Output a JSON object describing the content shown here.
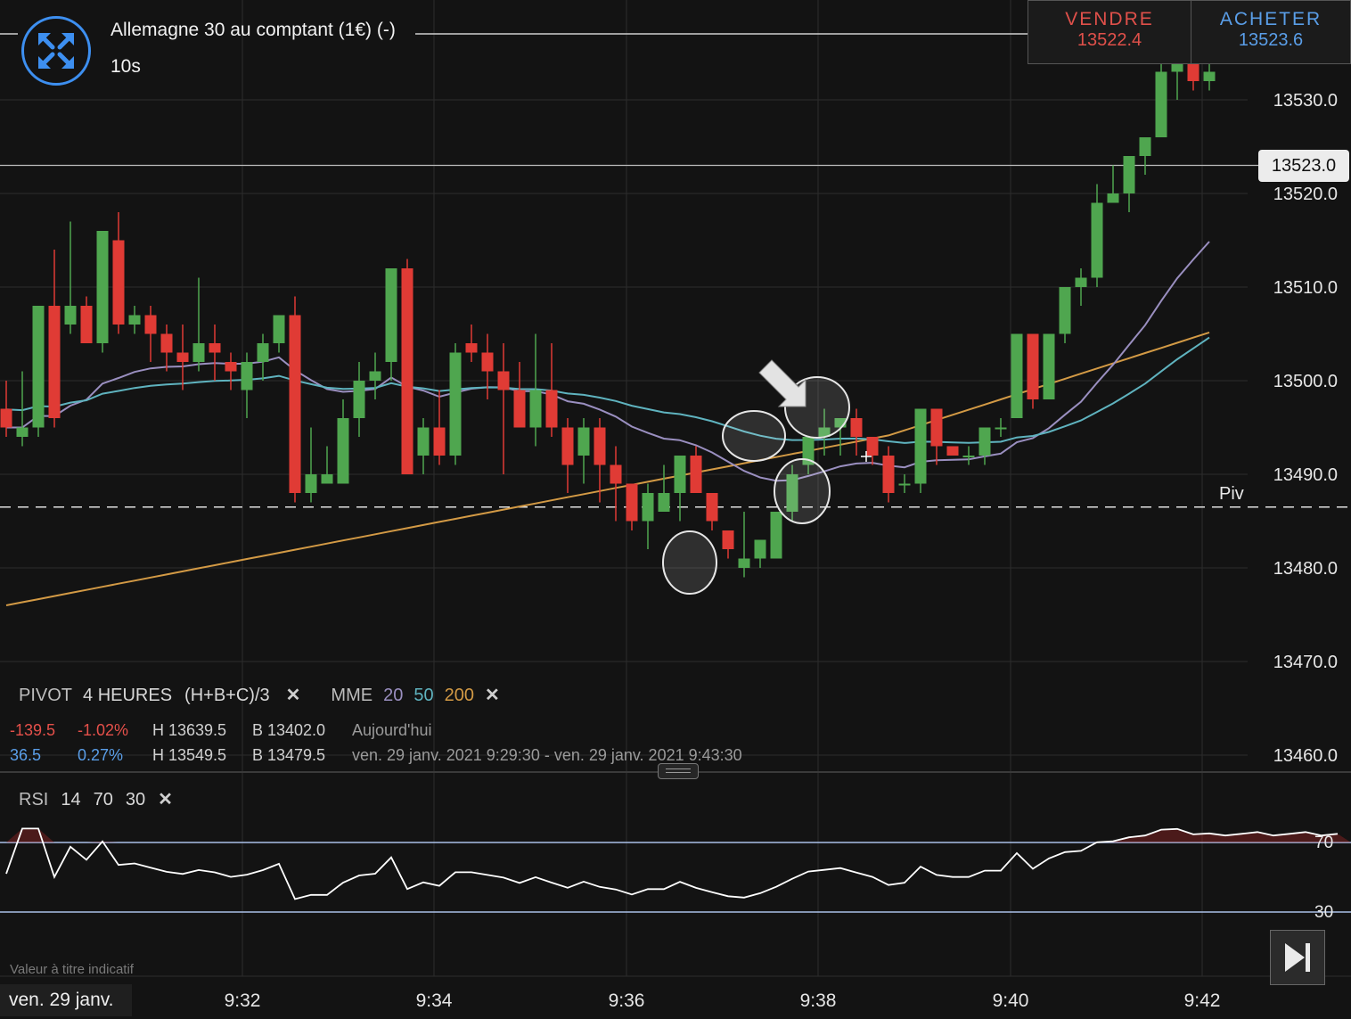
{
  "header": {
    "instrument": "Allemagne 30 au comptant (1€) (-)",
    "timeframe": "10s"
  },
  "trade": {
    "sell_label": "VENDRE",
    "sell_price": "13522.4",
    "buy_label": "ACHETER",
    "buy_price": "13523.6"
  },
  "current_price": "13523.0",
  "pivot_label": "Piv",
  "legend": {
    "pivot": "PIVOT",
    "pivot_period": "4 HEURES",
    "pivot_formula": "(H+B+C)/3",
    "mme": "MME",
    "mme_20": "20",
    "mme_50": "50",
    "mme_200": "200",
    "close": "✕"
  },
  "stats": {
    "row1": {
      "change": "-139.5",
      "pct": "-1.02%",
      "high": "H 13639.5",
      "low": "B 13402.0",
      "period": "Aujourd'hui"
    },
    "row2": {
      "change": "36.5",
      "pct": "0.27%",
      "high": "H 13549.5",
      "low": "B 13479.5",
      "period": "ven. 29 janv. 2021 9:29:30 - ven. 29 janv. 2021 9:43:30"
    }
  },
  "rsi": {
    "label": "RSI",
    "p1": "14",
    "p2": "70",
    "p3": "30",
    "upper": "70",
    "lower": "30"
  },
  "footer": {
    "date": "ven. 29 janv.",
    "disclaimer": "Valeur à titre indicatif"
  },
  "colors": {
    "up": "#4fa64f",
    "down": "#e03b35",
    "mme20": "#9a8fc0",
    "mme50": "#5fb3bf",
    "mme200": "#d39a45",
    "sell": "#e0504a",
    "buy": "#5a9ee8",
    "rsi_line": "#ffffff",
    "rsi_band": "#a9c0e8"
  },
  "icons": {
    "expand": "expand-arrows-icon",
    "skip": "skip-to-end-icon",
    "annotation": "arrow-pointer-icon"
  },
  "chart_data": {
    "type": "candlestick",
    "x_ticks": [
      "9:32",
      "9:34",
      "9:36",
      "9:38",
      "9:40",
      "9:42"
    ],
    "y_ticks": [
      "13530.0",
      "13520.0",
      "13510.0",
      "13500.0",
      "13490.0",
      "13480.0",
      "13470.0",
      "13460.0"
    ],
    "ylim": [
      13458,
      13540
    ],
    "pivot": 13486.5,
    "candles": [
      [
        13497,
        13500,
        13494,
        13495
      ],
      [
        13494,
        13501,
        13493,
        13495
      ],
      [
        13495,
        13505,
        13494,
        13508
      ],
      [
        13508,
        13514,
        13495,
        13496
      ],
      [
        13506,
        13517,
        13505,
        13508
      ],
      [
        13508,
        13509,
        13504,
        13504
      ],
      [
        13504,
        13516,
        13503,
        13516
      ],
      [
        13515,
        13518,
        13505,
        13506
      ],
      [
        13506,
        13508,
        13505,
        13507
      ],
      [
        13507,
        13508,
        13502,
        13505
      ],
      [
        13505,
        13506,
        13501,
        13503
      ],
      [
        13503,
        13506,
        13499,
        13502
      ],
      [
        13502,
        13511,
        13501,
        13504
      ],
      [
        13504,
        13506,
        13500,
        13503
      ],
      [
        13502,
        13503,
        13499,
        13501
      ],
      [
        13499,
        13503,
        13496,
        13502
      ],
      [
        13502,
        13505,
        13500,
        13504
      ],
      [
        13504,
        13507,
        13503,
        13507
      ],
      [
        13507,
        13509,
        13487,
        13488
      ],
      [
        13488,
        13495,
        13487,
        13490
      ],
      [
        13489,
        13493,
        13489,
        13490
      ],
      [
        13489,
        13498,
        13490,
        13496
      ],
      [
        13496,
        13502,
        13494,
        13500
      ],
      [
        13500,
        13503,
        13498,
        13501
      ],
      [
        13502,
        13512,
        13500,
        13512
      ],
      [
        13512,
        13513,
        13490,
        13490
      ],
      [
        13492,
        13496,
        13490,
        13495
      ],
      [
        13495,
        13499,
        13491,
        13492
      ],
      [
        13492,
        13504,
        13491,
        13503
      ],
      [
        13504,
        13506,
        13502,
        13503
      ],
      [
        13503,
        13505,
        13498,
        13501
      ],
      [
        13501,
        13504,
        13490,
        13499
      ],
      [
        13499,
        13502,
        13495,
        13495
      ],
      [
        13495,
        13505,
        13493,
        13499
      ],
      [
        13499,
        13504,
        13494,
        13495
      ],
      [
        13495,
        13496,
        13488,
        13491
      ],
      [
        13492,
        13496,
        13489,
        13495
      ],
      [
        13495,
        13496,
        13487,
        13491
      ],
      [
        13491,
        13493,
        13485,
        13489
      ],
      [
        13489,
        13489,
        13484,
        13485
      ],
      [
        13485,
        13489,
        13482,
        13488
      ],
      [
        13486,
        13491,
        13486,
        13488
      ],
      [
        13488,
        13492,
        13485,
        13492
      ],
      [
        13492,
        13493,
        13488,
        13488
      ],
      [
        13488,
        13488,
        13484,
        13485
      ],
      [
        13484,
        13484,
        13481,
        13482
      ],
      [
        13480,
        13486,
        13479,
        13481
      ],
      [
        13481,
        13483,
        13480,
        13483
      ],
      [
        13481,
        13486,
        13481,
        13486
      ],
      [
        13486,
        13491,
        13485,
        13490
      ],
      [
        13491,
        13494,
        13490,
        13494
      ],
      [
        13494,
        13497,
        13492,
        13495
      ],
      [
        13495,
        13496,
        13492,
        13496
      ],
      [
        13496,
        13497,
        13492,
        13494
      ],
      [
        13494,
        13494,
        13491,
        13492
      ],
      [
        13492,
        13493,
        13487,
        13488
      ],
      [
        13489,
        13490,
        13488,
        13489
      ],
      [
        13489,
        13497,
        13488,
        13497
      ],
      [
        13497,
        13497,
        13491,
        13493
      ],
      [
        13493,
        13493,
        13492,
        13492
      ],
      [
        13492,
        13493,
        13491,
        13492
      ],
      [
        13492,
        13495,
        13491,
        13495
      ],
      [
        13495,
        13496,
        13494,
        13495
      ],
      [
        13496,
        13505,
        13496,
        13505
      ],
      [
        13505,
        13505,
        13497,
        13498
      ],
      [
        13498,
        13505,
        13498,
        13505
      ],
      [
        13505,
        13510,
        13504,
        13510
      ],
      [
        13510,
        13512,
        13508,
        13511
      ],
      [
        13511,
        13521,
        13510,
        13519
      ],
      [
        13519,
        13523,
        13519,
        13520
      ],
      [
        13520,
        13524,
        13518,
        13524
      ],
      [
        13524,
        13526,
        13522,
        13526
      ],
      [
        13526,
        13534,
        13526,
        13533
      ],
      [
        13533,
        13537,
        13530,
        13534
      ],
      [
        13534,
        13535,
        13531,
        13532
      ],
      [
        13532,
        13536,
        13531,
        13533
      ]
    ]
  }
}
